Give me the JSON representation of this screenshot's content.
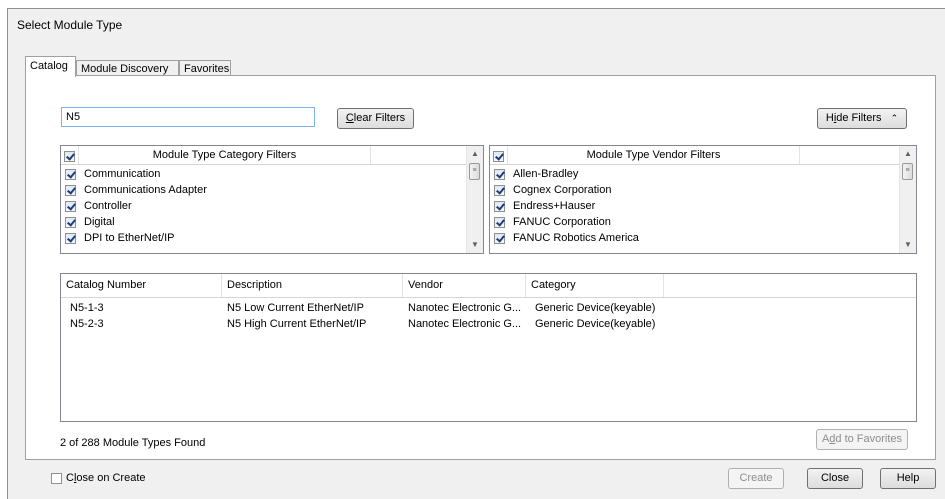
{
  "window": {
    "title": "Select Module Type"
  },
  "tabs": [
    {
      "label": "Catalog"
    },
    {
      "label": "Module Discovery"
    },
    {
      "label": "Favorites"
    }
  ],
  "search": {
    "value": "N5",
    "placeholder": ""
  },
  "buttons": {
    "clear_filters_prefix": "",
    "clear_filters_u": "C",
    "clear_filters_rest": "lear Filters",
    "hide_filters_prefix": "H",
    "hide_filters_u": "i",
    "hide_filters_rest": "de Filters",
    "hide_filters_glyph": "≈",
    "add_favorites_prefix": "A",
    "add_favorites_u": "d",
    "add_favorites_rest": "d to Favorites",
    "create": "Create",
    "close": "Close",
    "help": "Help"
  },
  "category_filters": {
    "header": "Module Type Category Filters",
    "items": [
      {
        "label": "Communication",
        "checked": true
      },
      {
        "label": "Communications Adapter",
        "checked": true
      },
      {
        "label": "Controller",
        "checked": true
      },
      {
        "label": "Digital",
        "checked": true
      },
      {
        "label": "DPI to EtherNet/IP",
        "checked": true
      }
    ]
  },
  "vendor_filters": {
    "header": "Module Type Vendor Filters",
    "items": [
      {
        "label": "Allen-Bradley",
        "checked": true
      },
      {
        "label": "Cognex Corporation",
        "checked": true
      },
      {
        "label": "Endress+Hauser",
        "checked": true
      },
      {
        "label": "FANUC Corporation",
        "checked": true
      },
      {
        "label": "FANUC Robotics America",
        "checked": true
      }
    ]
  },
  "results": {
    "columns": [
      "Catalog Number",
      "Description",
      "Vendor",
      "Category"
    ],
    "rows": [
      [
        "N5-1-3",
        "N5 Low Current EtherNet/IP",
        "Nanotec Electronic G...",
        "Generic Device(keyable)"
      ],
      [
        "N5-2-3",
        "N5 High Current EtherNet/IP",
        "Nanotec Electronic G...",
        "Generic Device(keyable)"
      ]
    ]
  },
  "status": "2 of 288 Module Types Found",
  "close_on_create": {
    "prefix": "C",
    "u": "l",
    "rest": "ose on Create",
    "checked": false
  }
}
